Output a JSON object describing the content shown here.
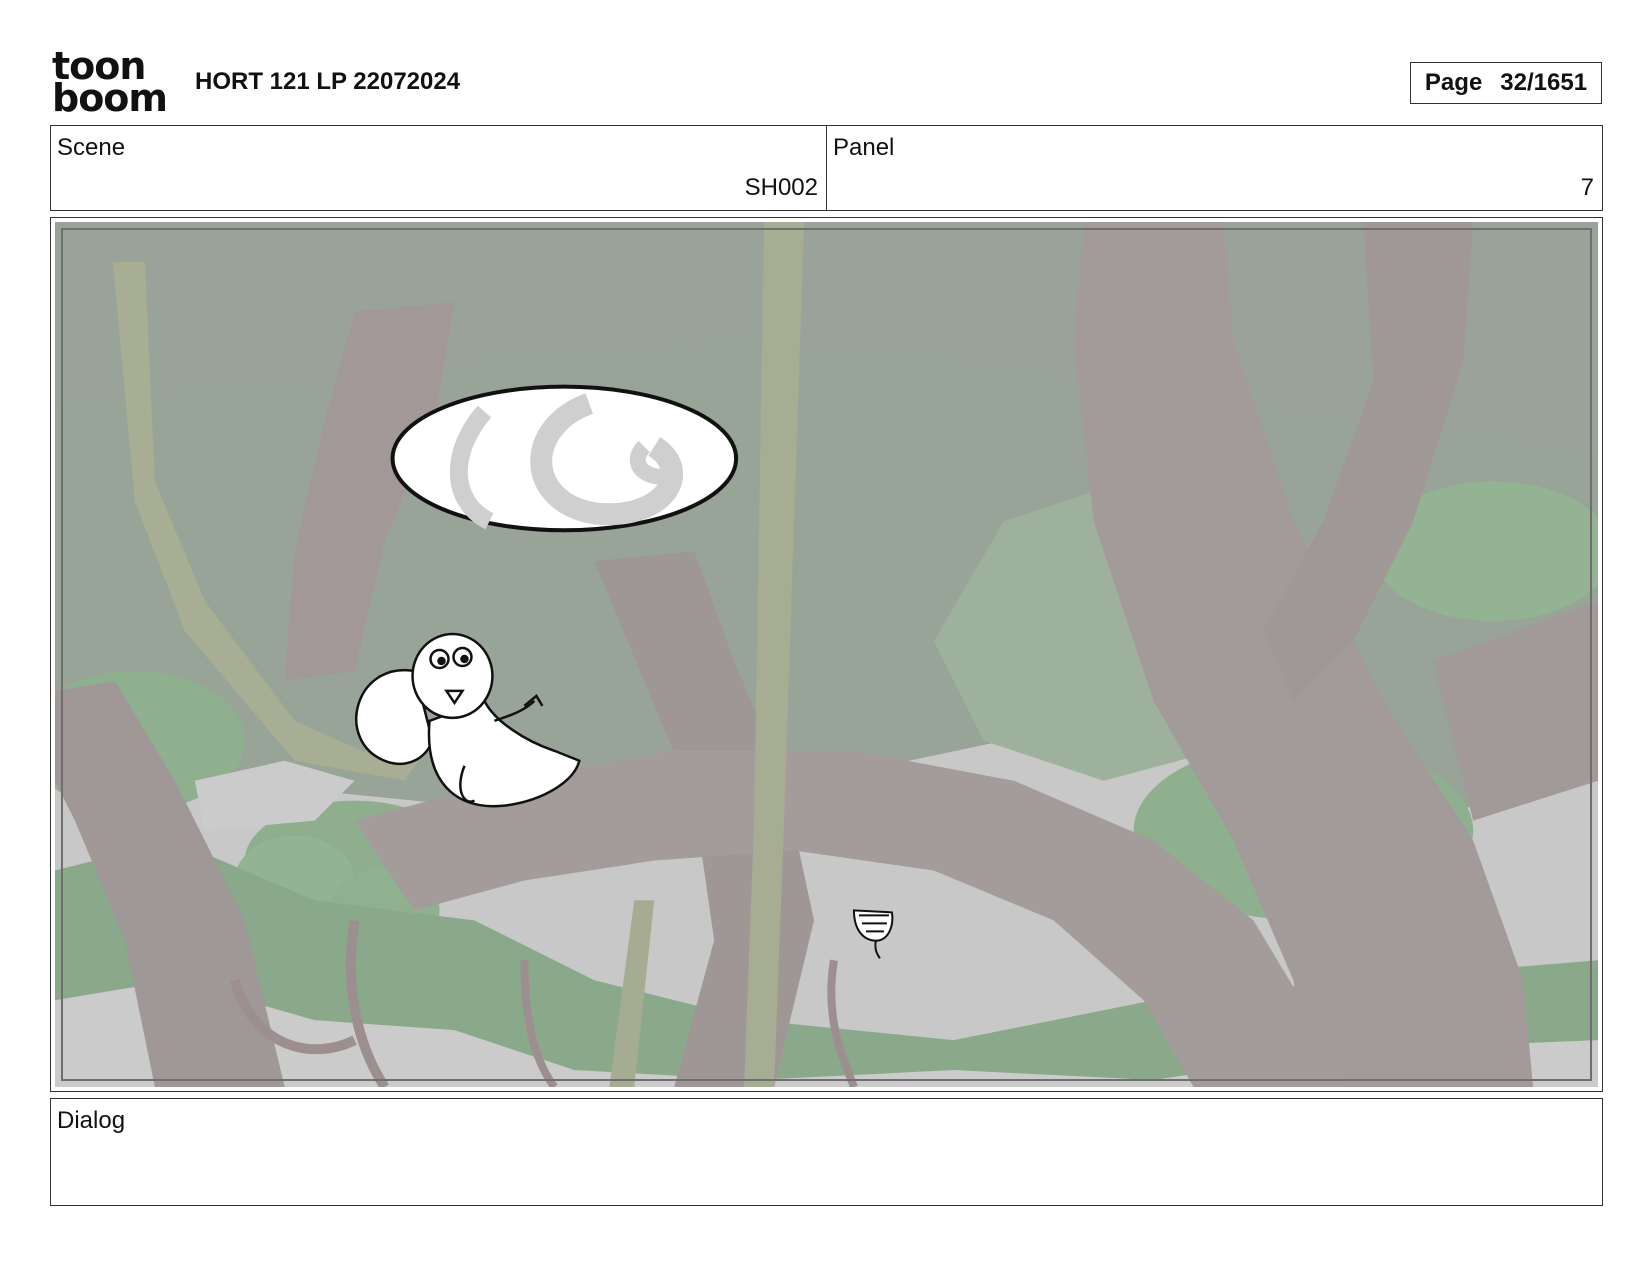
{
  "header": {
    "logo_line1": "toon",
    "logo_line2": "boom",
    "title": "HORT 121 LP 22072024",
    "page_label": "Page",
    "page_value": "32/1651"
  },
  "info": {
    "scene_label": "Scene",
    "scene_value": "SH002",
    "panel_label": "Panel",
    "panel_value": "7"
  },
  "panel": {
    "icons": [
      "squirrel-character",
      "swirl-disc",
      "acorn-character"
    ],
    "colors": {
      "sky": "#c9c9c9",
      "canopy": "#9aa79a",
      "leaves": "#8fb08f",
      "trunk": "#a39a9a",
      "vine": "#a7ad92"
    }
  },
  "dialog": {
    "label": "Dialog"
  }
}
